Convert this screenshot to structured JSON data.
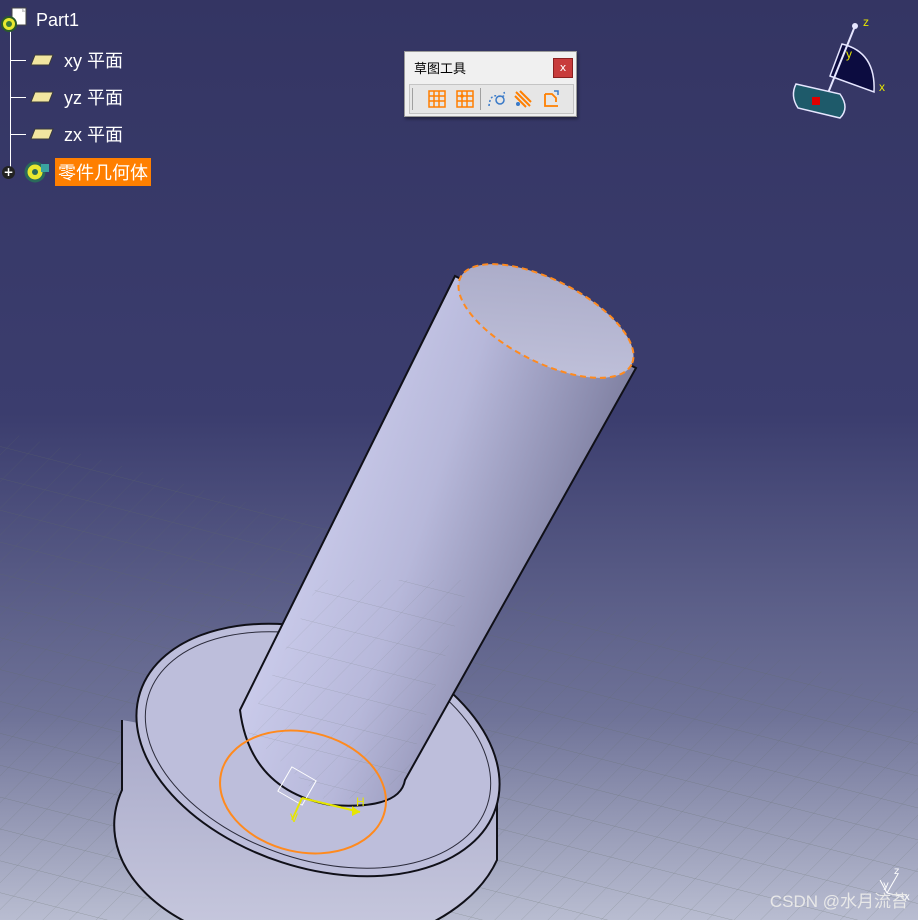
{
  "tree": {
    "root_label": "Part1",
    "items": [
      {
        "label": "xy 平面"
      },
      {
        "label": "yz 平面"
      },
      {
        "label": "zx 平面"
      }
    ],
    "body_label": "零件几何体",
    "highlight_color": "#ff7f00"
  },
  "toolbar": {
    "title": "草图工具",
    "close_label": "x",
    "buttons": [
      "grid-icon",
      "snap-to-point-icon",
      "construction-element-icon",
      "geometrical-constraints-icon",
      "dimensional-constraints-icon"
    ]
  },
  "compass": {
    "x_label": "x",
    "y_label": "y",
    "z_label": "z"
  },
  "sketch_axes": {
    "h_label": "H",
    "v_label": "V"
  },
  "corner_axes": {
    "x_label": "x",
    "y_label": "y",
    "z_label": "z"
  },
  "watermark": "CSDN @水月流苔",
  "colors": {
    "background_top": "#343563",
    "solid_face": "#c4c6e6",
    "selection_orange": "#ff8a1e",
    "axis_yellow": "#e6e600"
  }
}
